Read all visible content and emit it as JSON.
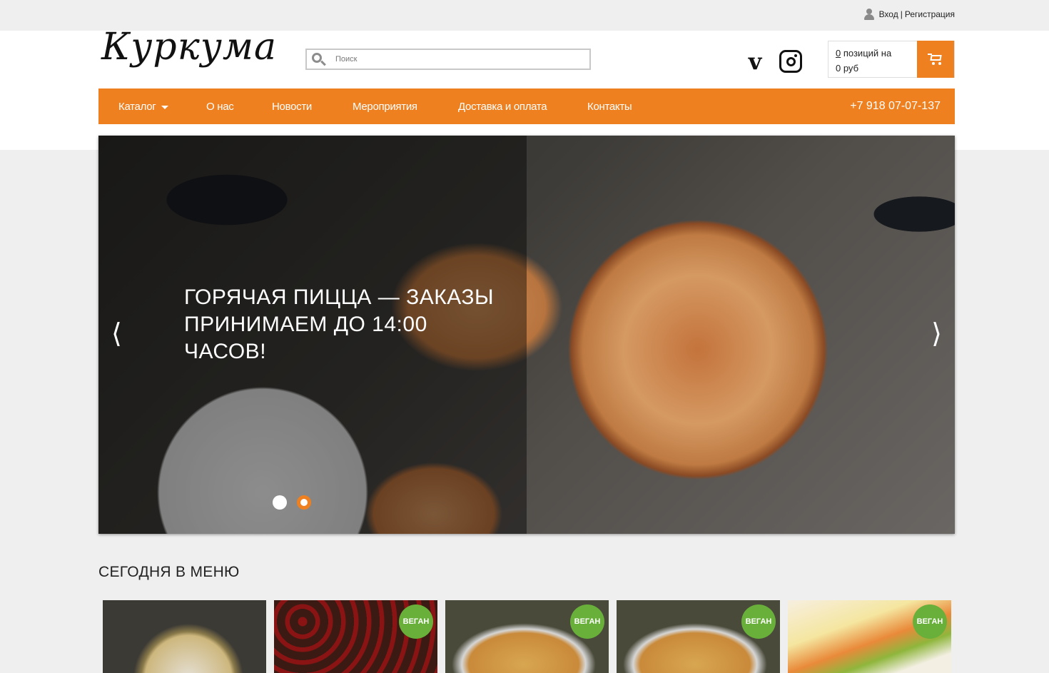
{
  "topbar": {
    "login_label": "Вход",
    "separator": "|",
    "register_label": "Регистрация"
  },
  "header": {
    "logo_text": "Куркума",
    "search_placeholder": "Поиск"
  },
  "cart": {
    "count": "0",
    "line1_suffix": " позиций на",
    "line2": "0 руб"
  },
  "nav": {
    "items": [
      {
        "label": "Каталог",
        "has_dropdown": true
      },
      {
        "label": "О нас"
      },
      {
        "label": "Новости"
      },
      {
        "label": "Мероприятия"
      },
      {
        "label": "Доставка и оплата"
      },
      {
        "label": "Контакты"
      }
    ],
    "phone": "+7 918 07-07-137"
  },
  "slider": {
    "title_line1": "ГОРЯЧАЯ ПИЦЦА — ЗАКАЗЫ",
    "title_line2": "ПРИНИМАЕМ ДО 14:00 ЧАСОВ!",
    "prev_arrow": "⟨",
    "next_arrow": "⟩",
    "slide_count": 2,
    "active_slide": 2
  },
  "menu_section": {
    "title": "СЕГОДНЯ В МЕНЮ",
    "cards": [
      {
        "badge": ""
      },
      {
        "badge": "ВЕГАН"
      },
      {
        "badge": "ВЕГАН"
      },
      {
        "badge": "ВЕГАН"
      },
      {
        "badge": "ВЕГАН"
      }
    ]
  },
  "colors": {
    "accent": "#ee8020",
    "vegan_badge": "#68b03a",
    "page_bg": "#efefef"
  }
}
